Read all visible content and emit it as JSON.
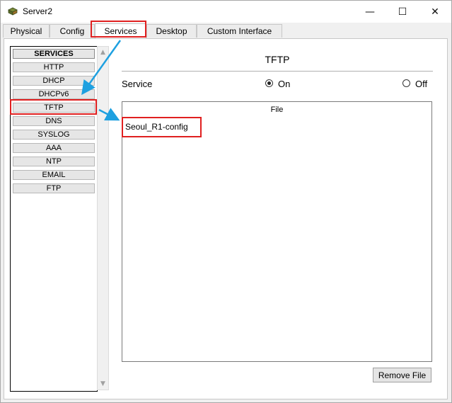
{
  "window": {
    "title": "Server2",
    "minimize_glyph": "—",
    "maximize_glyph": "☐",
    "close_glyph": "✕"
  },
  "tabs": [
    {
      "label": "Physical",
      "active": false
    },
    {
      "label": "Config",
      "active": false
    },
    {
      "label": "Services",
      "active": true
    },
    {
      "label": "Desktop",
      "active": false
    },
    {
      "label": "Custom Interface",
      "active": false
    }
  ],
  "sidebar": {
    "header": "SERVICES",
    "items": [
      "HTTP",
      "DHCP",
      "DHCPv6",
      "TFTP",
      "DNS",
      "SYSLOG",
      "AAA",
      "NTP",
      "EMAIL",
      "FTP"
    ],
    "selected": "TFTP"
  },
  "panel": {
    "title": "TFTP",
    "service_label": "Service",
    "on_label": "On",
    "off_label": "Off",
    "selected_option": "On",
    "file_column": "File",
    "files": [
      "Seoul_R1-config"
    ],
    "remove_button": "Remove File"
  },
  "icons": {
    "app": "server-icon",
    "scroll_up": "chevron-up-icon",
    "scroll_down": "chevron-down-icon"
  },
  "colors": {
    "highlight": "#e02020",
    "arrow": "#1ea0e0"
  }
}
